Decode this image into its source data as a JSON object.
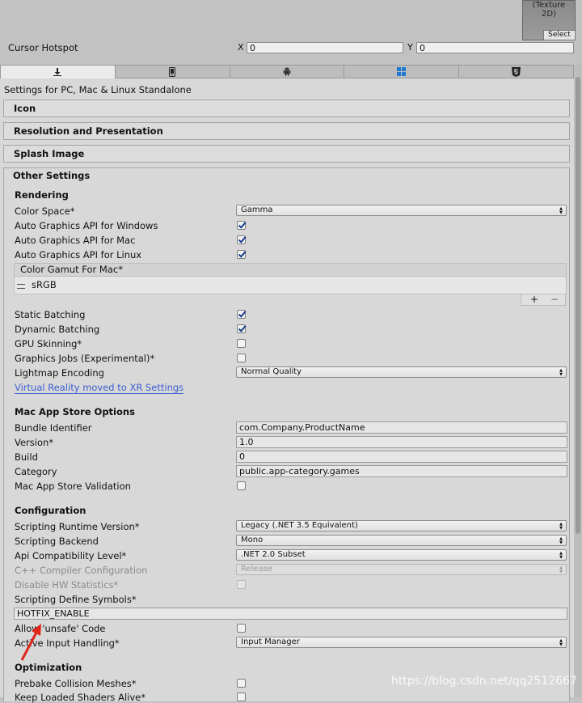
{
  "texture": {
    "label": "(Texture\n2D)",
    "select": "Select"
  },
  "cursor_hotspot": {
    "label": "Cursor Hotspot",
    "x_label": "X",
    "x_value": "0",
    "y_label": "Y",
    "y_value": "0"
  },
  "tabs": [
    {
      "icon": "download-icon"
    },
    {
      "icon": "phone-icon"
    },
    {
      "icon": "android-icon"
    },
    {
      "icon": "windows-icon"
    },
    {
      "icon": "html5-icon"
    }
  ],
  "settings_for": "Settings for PC, Mac & Linux Standalone",
  "sections": {
    "icon": "Icon",
    "resolution": "Resolution and Presentation",
    "splash": "Splash Image",
    "other": "Other Settings"
  },
  "rendering": {
    "heading": "Rendering",
    "color_space": {
      "label": "Color Space*",
      "value": "Gamma"
    },
    "auto_win": {
      "label": "Auto Graphics API  for Windows",
      "checked": true
    },
    "auto_mac": {
      "label": "Auto Graphics API  for Mac",
      "checked": true
    },
    "auto_linux": {
      "label": "Auto Graphics API  for Linux",
      "checked": true
    },
    "gamut_header": "Color Gamut For Mac*",
    "gamut_item": "sRGB",
    "plus": "+",
    "minus": "−",
    "static_batching": {
      "label": "Static Batching",
      "checked": true
    },
    "dynamic_batching": {
      "label": "Dynamic Batching",
      "checked": true
    },
    "gpu_skinning": {
      "label": "GPU Skinning*",
      "checked": false
    },
    "graphics_jobs": {
      "label": "Graphics Jobs (Experimental)*",
      "checked": false
    },
    "lightmap": {
      "label": "Lightmap Encoding",
      "value": "Normal Quality"
    },
    "vr_link": "Virtual Reality moved to XR Settings"
  },
  "mac_store": {
    "heading": "Mac App Store Options",
    "bundle": {
      "label": "Bundle Identifier",
      "value": "com.Company.ProductName"
    },
    "version": {
      "label": "Version*",
      "value": "1.0"
    },
    "build": {
      "label": "Build",
      "value": "0"
    },
    "category": {
      "label": "Category",
      "value": "public.app-category.games"
    },
    "validation": {
      "label": "Mac App Store Validation",
      "checked": false
    }
  },
  "configuration": {
    "heading": "Configuration",
    "runtime": {
      "label": "Scripting Runtime Version*",
      "value": "Legacy (.NET 3.5 Equivalent)"
    },
    "backend": {
      "label": "Scripting Backend",
      "value": "Mono"
    },
    "api": {
      "label": "Api Compatibility Level*",
      "value": ".NET 2.0 Subset"
    },
    "cpp": {
      "label": "C++ Compiler Configuration",
      "value": "Release"
    },
    "hw_stats": {
      "label": "Disable HW Statistics*",
      "checked": false
    },
    "define_symbols": {
      "label": "Scripting Define Symbols*",
      "value": "HOTFIX_ENABLE"
    },
    "unsafe": {
      "label": "Allow 'unsafe' Code",
      "checked": false
    },
    "input": {
      "label": "Active Input Handling*",
      "value": "Input Manager"
    }
  },
  "optimization": {
    "heading": "Optimization",
    "prebake": {
      "label": "Prebake Collision Meshes*",
      "checked": false
    },
    "keep_shaders": {
      "label": "Keep Loaded Shaders Alive*",
      "checked": false
    }
  },
  "watermark": "https://blog.csdn.net/qq2512667",
  "colors": {
    "accent_link": "#3c5fd1",
    "arrow": "#e0251b",
    "check": "#1b3e8a"
  }
}
